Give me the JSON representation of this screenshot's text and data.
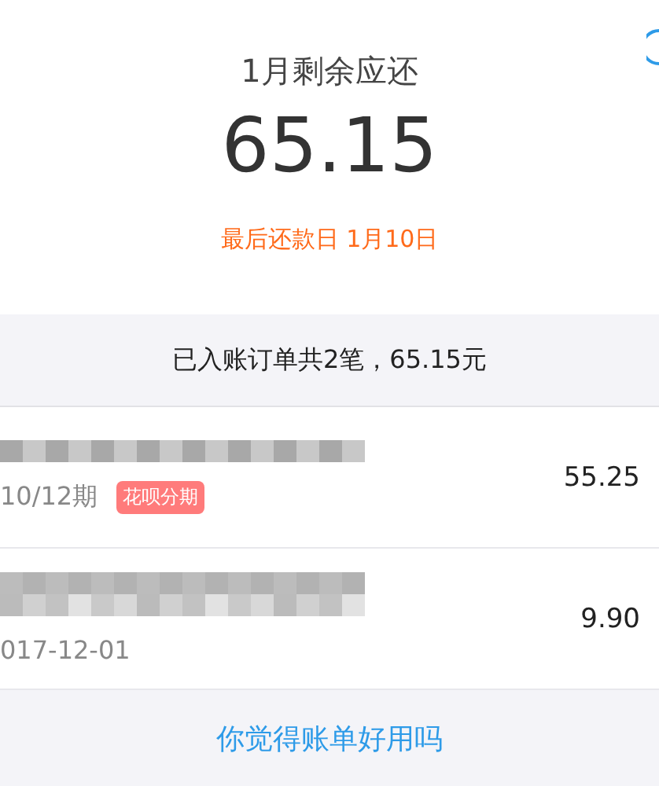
{
  "header": {
    "title": "1月剩余应还",
    "amount": "65.15",
    "due": "最后还款日 1月10日"
  },
  "summary": "已入账订单共2笔，65.15元",
  "orders": [
    {
      "detail": "10/12期",
      "tag": "花呗分期",
      "amount": "55.25"
    },
    {
      "detail": "017-12-01",
      "amount": "9.90"
    }
  ],
  "feedback_link": "你觉得账单好用吗"
}
